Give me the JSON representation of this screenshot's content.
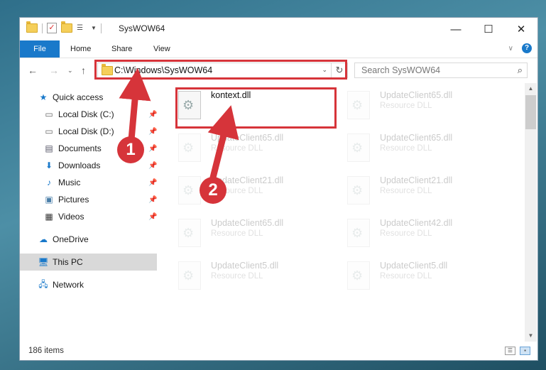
{
  "window": {
    "title": "SysWOW64"
  },
  "caption": {
    "minimize": "—",
    "maximize": "☐",
    "close": "✕"
  },
  "ribbon": {
    "file": "File",
    "tabs": [
      "Home",
      "Share",
      "View"
    ]
  },
  "nav": {
    "address": "C:\\Windows\\SysWOW64",
    "search_placeholder": "Search SysWOW64"
  },
  "sidebar": {
    "items": [
      {
        "label": "Quick access",
        "icon": "star-icon"
      },
      {
        "label": "Local Disk (C:)",
        "icon": "drive-icon",
        "pinned": true
      },
      {
        "label": "Local Disk (D:)",
        "icon": "drive-icon",
        "pinned": true
      },
      {
        "label": "Documents",
        "icon": "documents-icon",
        "pinned": true
      },
      {
        "label": "Downloads",
        "icon": "download-icon",
        "pinned": true
      },
      {
        "label": "Music",
        "icon": "music-icon",
        "pinned": true
      },
      {
        "label": "Pictures",
        "icon": "pictures-icon",
        "pinned": true
      },
      {
        "label": "Videos",
        "icon": "videos-icon",
        "pinned": true
      },
      {
        "label": "OneDrive",
        "icon": "cloud-icon"
      },
      {
        "label": "This PC",
        "icon": "computer-icon",
        "selected": true
      },
      {
        "label": "Network",
        "icon": "network-icon"
      }
    ]
  },
  "files": [
    {
      "name": "kontext.dll",
      "type": ""
    },
    {
      "name": "UpdateClient65.dll",
      "type": "Resource DLL"
    },
    {
      "name": "UpdateClient65.dll",
      "type": "Resource DLL"
    },
    {
      "name": "UpdateClient65.dll",
      "type": "Resource DLL"
    },
    {
      "name": "UpdateClient21.dll",
      "type": "Resource DLL"
    },
    {
      "name": "UpdateClient21.dll",
      "type": "Resource DLL"
    },
    {
      "name": "UpdateClient65.dll",
      "type": "Resource DLL"
    },
    {
      "name": "UpdateClient42.dll",
      "type": "Resource DLL"
    },
    {
      "name": "UpdateClient5.dll",
      "type": "Resource DLL"
    },
    {
      "name": "UpdateClient5.dll",
      "type": "Resource DLL"
    }
  ],
  "status": {
    "item_count": "186 items"
  },
  "annotations": {
    "step1": "1",
    "step2": "2",
    "color": "#d6343a"
  }
}
